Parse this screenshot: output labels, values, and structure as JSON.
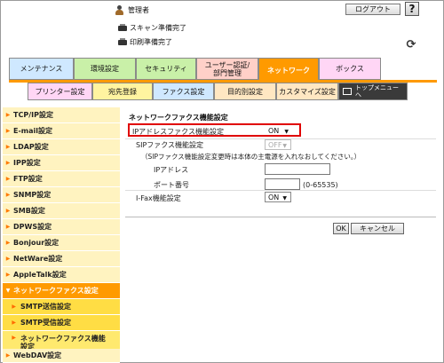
{
  "header": {
    "user_label": "管理者",
    "logout_label": "ログアウト",
    "help_label": "?",
    "status": [
      "スキャン準備完了",
      "印刷準備完了"
    ],
    "refresh_icon": "refresh-icon"
  },
  "main_tabs": [
    {
      "label": "メンテナンス",
      "color": "#cfe8ff"
    },
    {
      "label": "環境設定",
      "color": "#c9f0a8"
    },
    {
      "label": "セキュリティ",
      "color": "#c9f0a8"
    },
    {
      "label": "ユーザー認証/部門管理",
      "color": "#ffd0c8"
    },
    {
      "label": "ネットワーク",
      "color": "#ff9a00",
      "active": true
    },
    {
      "label": "ボックス",
      "color": "#ffd6f5"
    }
  ],
  "sub_tabs": [
    {
      "label": "プリンター設定",
      "color": "#ffd6f5"
    },
    {
      "label": "宛先登録",
      "color": "#fff4a0"
    },
    {
      "label": "ファクス設定",
      "color": "#cfe8ff"
    },
    {
      "label": "目的別設定",
      "color": "#ffe7c2"
    },
    {
      "label": "カスタマイズ設定",
      "color": "#ffe7c2"
    },
    {
      "label": "トップメニューへ",
      "color": "#3a3a3a"
    }
  ],
  "sidebar": {
    "items": [
      {
        "label": "TCP/IP設定"
      },
      {
        "label": "E-mail設定"
      },
      {
        "label": "LDAP設定"
      },
      {
        "label": "IPP設定"
      },
      {
        "label": "FTP設定"
      },
      {
        "label": "SNMP設定"
      },
      {
        "label": "SMB設定"
      },
      {
        "label": "DPWS設定"
      },
      {
        "label": "Bonjour設定"
      },
      {
        "label": "NetWare設定"
      },
      {
        "label": "AppleTalk設定"
      },
      {
        "label": "ネットワークファクス設定",
        "active": true
      },
      {
        "label": "SMTP送信設定",
        "sub": true
      },
      {
        "label": "SMTP受信設定",
        "sub": true
      },
      {
        "label": "ネットワークファクス機能設定",
        "sub": true,
        "selected": true
      },
      {
        "label": "WebDAV設定"
      }
    ]
  },
  "main": {
    "title": "ネットワークファクス機能設定",
    "ip_fax_label": "IPアドレスファクス機能設定",
    "ip_fax_value": "ON",
    "sip_fax_label": "SIPファクス機能設定",
    "sip_fax_value": "OFF",
    "sip_note": "（SIPファクス機能設定変更時は本体の主電源を入れなおしてください。）",
    "ip_address_label": "IPアドレス",
    "ip_address_value": "",
    "port_label": "ポート番号",
    "port_value": "",
    "port_range": "(0-65535)",
    "ifax_label": "I-Fax機能設定",
    "ifax_value": "ON",
    "ok_label": "OK",
    "cancel_label": "キャンセル"
  }
}
